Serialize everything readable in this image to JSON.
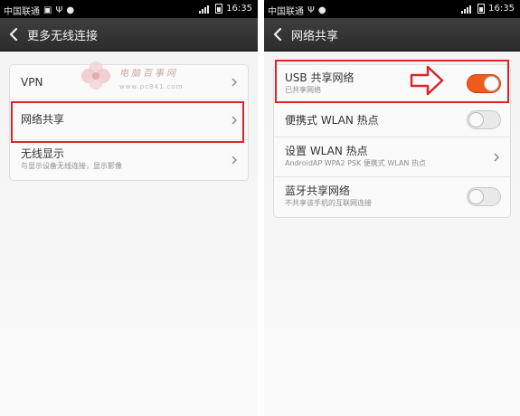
{
  "status_bar": {
    "carrier": "中国联通",
    "time": "16:35"
  },
  "left_screen": {
    "title": "更多无线连接",
    "items": [
      {
        "label": "VPN",
        "sub": ""
      },
      {
        "label": "网络共享",
        "sub": ""
      },
      {
        "label": "无线显示",
        "sub": "与显示设备无线连接，显示影像"
      }
    ]
  },
  "right_screen": {
    "title": "网络共享",
    "items": [
      {
        "label": "USB 共享网络",
        "sub": "已共享网络",
        "toggle": "on"
      },
      {
        "label": "便携式 WLAN 热点",
        "sub": "",
        "toggle": "off"
      },
      {
        "label": "设置 WLAN 热点",
        "sub": "AndroidAP WPA2 PSK 便携式 WLAN 热点",
        "toggle": null
      },
      {
        "label": "蓝牙共享网络",
        "sub": "不共享该手机的互联网连接",
        "toggle": "off"
      }
    ]
  },
  "watermark": {
    "text": "电脑百事网",
    "url": "www.pc841.com"
  },
  "colors": {
    "toggle_on": "#ee5b1c",
    "highlight": "#d7262c"
  },
  "icons": [
    "image-icon",
    "usb-icon",
    "android-icon",
    "signal-icon",
    "battery-icon",
    "back-arrow-icon",
    "chevron-right-icon",
    "right-arrow-icon"
  ]
}
